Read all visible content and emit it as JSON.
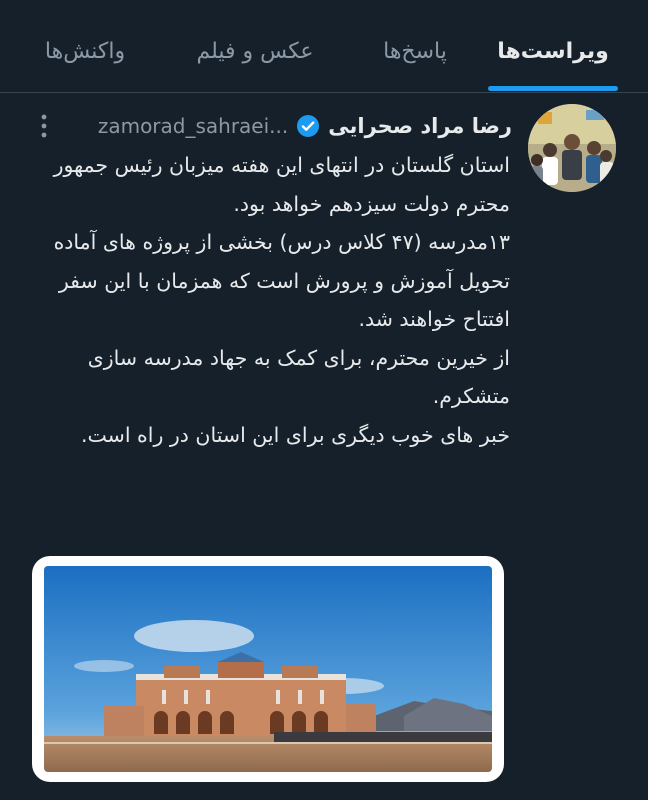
{
  "tabs": [
    {
      "label": "ویراست‌ها",
      "active": true
    },
    {
      "label": "پاسخ‌ها",
      "active": false
    },
    {
      "label": "عکس و فیلم",
      "active": false
    },
    {
      "label": "واکنش‌ها",
      "active": false
    }
  ],
  "tweet": {
    "display_name": "رضا مراد صحرایی",
    "handle": "zamorad_sahraei...",
    "verified": true,
    "text": "استان گلستان در انتهای این هفته میزبان رئیس جمهور محترم دولت سیزدهم خواهد بود.\n۱۳مدرسه (۴۷ کلاس درس) بخشی از پروژه های آماده تحویل آموزش و پرورش است که همزمان با این سفر افتتاح خواهند شد.\nاز خیرین محترم، برای کمک به جهاد مدرسه سازی متشکرم.\nخبر های خوب دیگری برای این استان در راه است."
  },
  "icons": {
    "verified": "verified-badge-icon",
    "more": "more-options-icon"
  },
  "colors": {
    "background": "#15202b",
    "accent": "#1d9bf0",
    "text_primary": "#e7e9ea",
    "text_secondary": "#8b98a5"
  }
}
